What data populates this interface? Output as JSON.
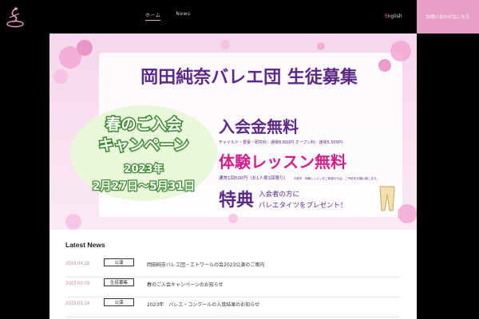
{
  "header": {
    "logo_icon": "ballet-dancer-logo-icon",
    "nav": [
      {
        "label": "ホーム",
        "active": true
      },
      {
        "label": "News",
        "active": false
      }
    ],
    "lang_first": "E",
    "lang_rest": "nglish",
    "contact_label": "お問い合わせはこちら",
    "contact_color": "#e8a0c6"
  },
  "banner": {
    "title": "岡田純奈バレエ団 生徒募集",
    "campaign_line1": "春のご入会",
    "campaign_line2": "キャンペーン",
    "campaign_year": "2023年",
    "campaign_period": "2月27日〜5月31日",
    "fee_free": "入会金無料",
    "fee_note": "チャイルド・豊豪・研究科：通常8,800円 オープン科：通常5,500円",
    "trial_free": "体験レッスン無料",
    "trial_note": "通常1回500円（お1人様1回限り）",
    "trial_note_small": "※見学・体験レッスンをご希望の方は、ご予約をお願い致します。",
    "bonus_label": "特典",
    "bonus_text_1": "入会者の方に",
    "bonus_text_2": "バレエタイツをプレゼント！"
  },
  "news": {
    "heading": "Latest News",
    "items": [
      {
        "date": "2023.04.28",
        "category": "公演",
        "title": "岡田純奈バレエ団・エトワールの会2023公演のご案内"
      },
      {
        "date": "2023.03.03",
        "category": "生徒募集",
        "title": "春のご入会キャンペーンのお知らせ"
      },
      {
        "date": "2023.01.14",
        "category": "公演",
        "title": "2023年　バレエ・コンクールの入賞結果のお知らせ"
      }
    ]
  },
  "colors": {
    "accent_pink": "#e8a0c6",
    "purple": "#5c2a86",
    "magenta": "#d21f8a",
    "campaign_green": "#3b8a2e"
  }
}
